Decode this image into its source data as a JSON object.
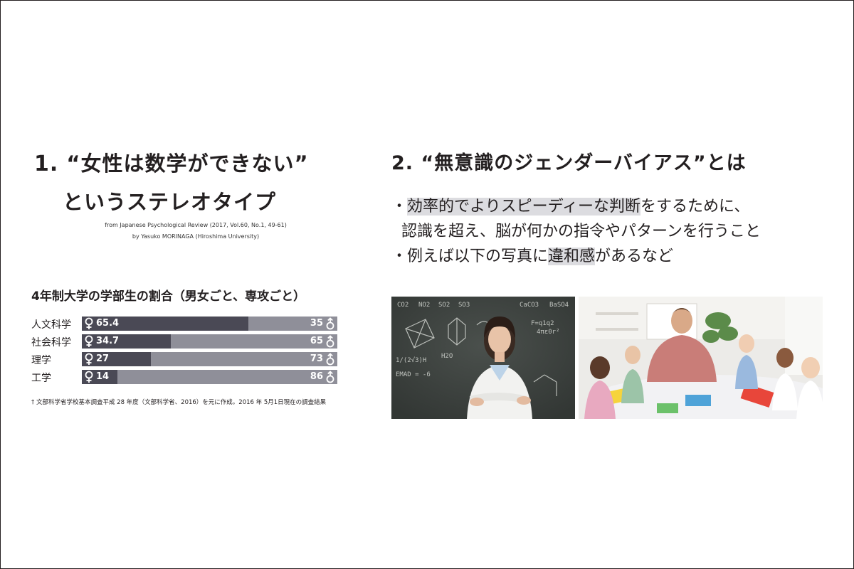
{
  "left": {
    "title_num": "1.",
    "title_line1": "“女性は数学ができない”",
    "title_line2": "というステレオタイプ",
    "source_line1": "from Japanese Psychological Review (2017, Vol.60, No.1, 49-61)",
    "source_line2": "by Yasuko MORINAGA (Hiroshima University)",
    "footnote": "† 文部科学省学校基本調査平成 28 年度（文部科学省、2016）を元に作成。2016 年 5月1日現在の調査結果"
  },
  "chart_data": {
    "type": "bar",
    "title": "4年制大学の学部生の割合（男女ごと、専攻ごと）",
    "categories": [
      "人文科学",
      "社会科学",
      "理学",
      "工学"
    ],
    "series": [
      {
        "values": [
          65.4,
          34.7,
          27,
          14
        ]
      },
      {
        "values": [
          35,
          65,
          73,
          86
        ]
      }
    ],
    "stacked": true,
    "orientation": "horizontal",
    "colors": {
      "female": "#4a4955",
      "male": "#8f8f99"
    },
    "icons": {
      "female": "female-symbol-icon",
      "male": "male-symbol-icon"
    },
    "labels_female": [
      "65.4",
      "34.7",
      "27",
      "14"
    ],
    "labels_male": [
      "35",
      "65",
      "73",
      "86"
    ]
  },
  "right": {
    "title": "2. “無意識のジェンダーバイアス”とは",
    "bullet1_pre": "・",
    "bullet1_hl": "効率的でよりスピーディーな判断",
    "bullet1_post": "をするために、",
    "bullet1_line2": "認識を超え、脳が何かの指令やパターンを行うこと",
    "bullet2_pre": "・例えば以下の写真に",
    "bullet2_hl": "違和感",
    "bullet2_post": "があるなど",
    "chalk_text": [
      "CO2",
      "NO2",
      "SO2",
      "SO3",
      "CaCO3",
      "BaSO4",
      "F=q1q2",
      "4πε0r²",
      "1/(2√3)H",
      "H2O",
      "EMAD = -6"
    ]
  }
}
